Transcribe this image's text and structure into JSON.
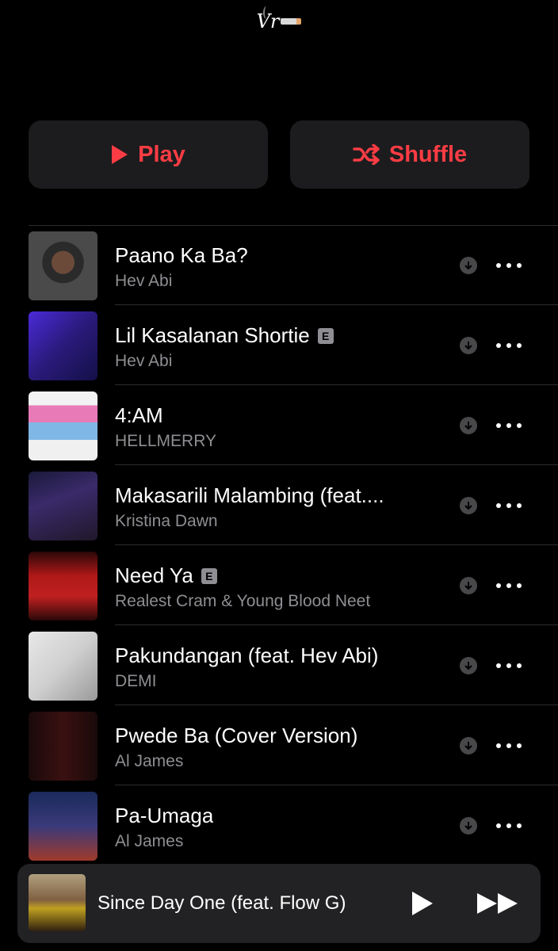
{
  "header": {
    "title": "Vr",
    "emoji_name": "cigarette-emoji"
  },
  "actions": {
    "play_label": "Play",
    "shuffle_label": "Shuffle"
  },
  "accent_color": "#fc3c44",
  "tracks": [
    {
      "title": "Paano Ka Ba?",
      "artist": "Hev Abi",
      "explicit": false
    },
    {
      "title": "Lil Kasalanan Shortie",
      "artist": "Hev Abi",
      "explicit": true,
      "explicit_label": "E"
    },
    {
      "title": "4:AM",
      "artist": "HELLMERRY",
      "explicit": false
    },
    {
      "title": "Makasarili Malambing (feat....",
      "artist": "Kristina Dawn",
      "explicit": false
    },
    {
      "title": "Need Ya",
      "artist": "Realest Cram & Young Blood Neet",
      "explicit": true,
      "explicit_label": "E"
    },
    {
      "title": "Pakundangan (feat. Hev Abi)",
      "artist": "DEMI",
      "explicit": false
    },
    {
      "title": "Pwede Ba (Cover Version)",
      "artist": "Al James",
      "explicit": false
    },
    {
      "title": "Pa-Umaga",
      "artist": "Al James",
      "explicit": false
    }
  ],
  "now_playing": {
    "title": "Since Day One (feat. Flow G)"
  }
}
